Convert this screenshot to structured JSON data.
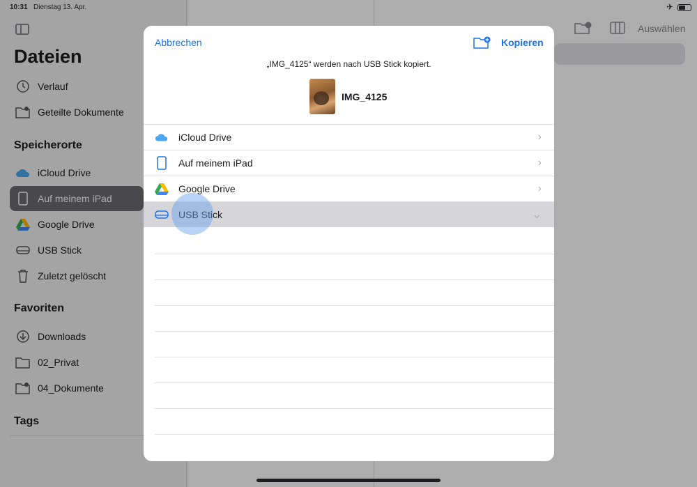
{
  "status": {
    "time": "10:31",
    "date": "Dienstag 13. Apr."
  },
  "sidebar": {
    "title": "Dateien",
    "top_items": [
      {
        "label": "Verlauf",
        "icon": "clock-icon"
      },
      {
        "label": "Geteilte Dokumente",
        "icon": "shared-folder-icon"
      }
    ],
    "locations_header": "Speicherorte",
    "locations": [
      {
        "label": "iCloud Drive",
        "icon": "icloud-icon"
      },
      {
        "label": "Auf meinem iPad",
        "icon": "ipad-icon",
        "active": true
      },
      {
        "label": "Google Drive",
        "icon": "google-drive-icon"
      },
      {
        "label": "USB Stick",
        "icon": "drive-icon"
      },
      {
        "label": "Zuletzt gelöscht",
        "icon": "trash-icon"
      }
    ],
    "favorites_header": "Favoriten",
    "favorites": [
      {
        "label": "Downloads",
        "icon": "download-icon"
      },
      {
        "label": "02_Privat",
        "icon": "folder-icon"
      },
      {
        "label": "04_Dokumente",
        "icon": "shared-folder-icon"
      }
    ],
    "tags_header": "Tags"
  },
  "toolbar": {
    "select_label": "Auswählen"
  },
  "modal": {
    "cancel_label": "Abbrechen",
    "copy_label": "Kopieren",
    "message": "„IMG_4125“ werden nach USB Stick kopiert.",
    "file_name": "IMG_4125",
    "locations": [
      {
        "label": "iCloud Drive",
        "icon": "icloud-icon",
        "expanded": false
      },
      {
        "label": "Auf meinem iPad",
        "icon": "ipad-icon",
        "expanded": false
      },
      {
        "label": "Google Drive",
        "icon": "google-drive-icon",
        "expanded": false
      },
      {
        "label": "USB Stick",
        "icon": "drive-icon",
        "expanded": true,
        "selected": true
      }
    ]
  },
  "colors": {
    "accent": "#1a73e8",
    "selected_row": "#d6d6da"
  }
}
